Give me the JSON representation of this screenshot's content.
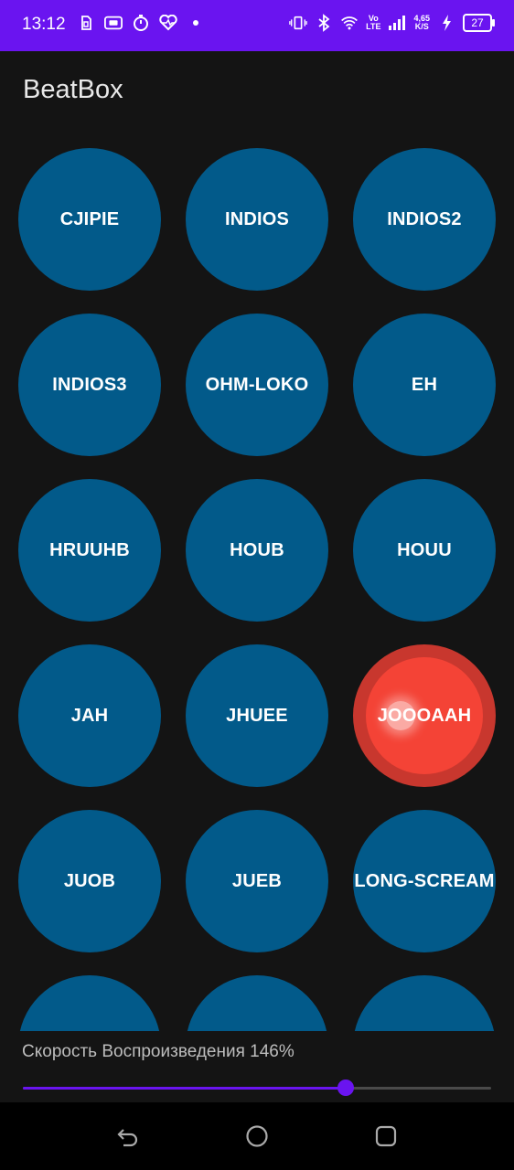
{
  "status_bar": {
    "time": "13:12",
    "left_icons": [
      "sim-icon",
      "screen-icon",
      "timer-icon",
      "heart-rate-icon",
      "dot-icon"
    ],
    "right_icons": [
      "vibrate-icon",
      "bluetooth-icon",
      "wifi-icon",
      "volte-icon",
      "signal-icon"
    ],
    "network_speed_value": "4,65",
    "network_speed_unit": "K/S",
    "volte_line1": "Vo",
    "volte_line2": "LTE",
    "battery": "27",
    "bg_color": "#6a14f0"
  },
  "app": {
    "title": "BeatBox"
  },
  "pads": [
    {
      "label": "CJIPIE",
      "active": false
    },
    {
      "label": "INDIOS",
      "active": false
    },
    {
      "label": "INDIOS2",
      "active": false
    },
    {
      "label": "INDIOS3",
      "active": false
    },
    {
      "label": "OHM-LOKO",
      "active": false
    },
    {
      "label": "EH",
      "active": false
    },
    {
      "label": "HRUUHB",
      "active": false
    },
    {
      "label": "HOUB",
      "active": false
    },
    {
      "label": "HOUU",
      "active": false
    },
    {
      "label": "JAH",
      "active": false
    },
    {
      "label": "JHUEE",
      "active": false
    },
    {
      "label": "JOOOAAH",
      "active": true
    },
    {
      "label": "JUOB",
      "active": false
    },
    {
      "label": "JUEB",
      "active": false
    },
    {
      "label": "LONG-SCREAM",
      "active": false
    },
    {
      "label": "",
      "active": false
    },
    {
      "label": "",
      "active": false
    },
    {
      "label": "",
      "active": false
    }
  ],
  "colors": {
    "pad": "#025a8a",
    "pad_active": "#f44336",
    "accent": "#6a14f0",
    "background": "#141414"
  },
  "playback": {
    "label": "Скорость Воспроизведения 146%",
    "slider_fraction": 0.69
  },
  "nav_bar": {
    "buttons": [
      "back-icon",
      "home-icon",
      "recents-icon"
    ]
  }
}
